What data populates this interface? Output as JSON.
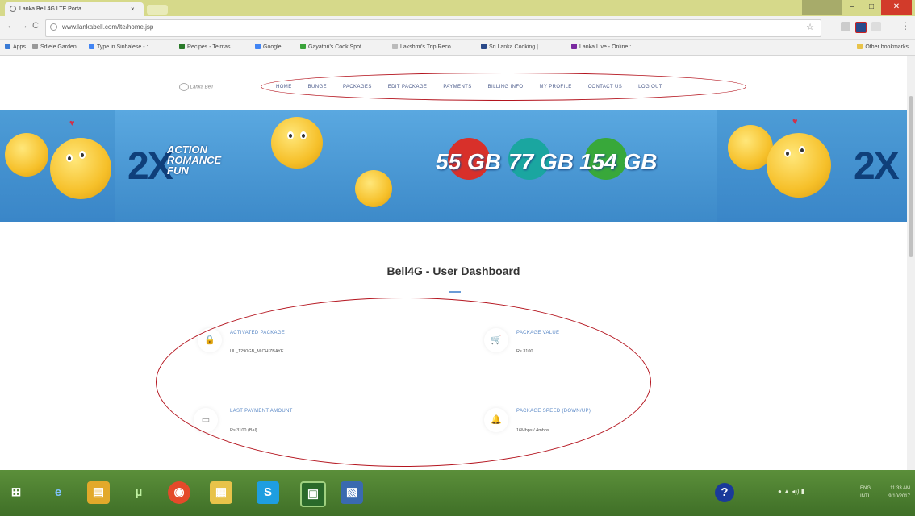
{
  "browser": {
    "tab_title": "Lanka Bell 4G LTE Porta",
    "tab_close": "×",
    "url": "www.lankabell.com/lte/home.jsp",
    "back": "←",
    "forward": "→",
    "reload": "C",
    "star": "☆",
    "menu": "⋮"
  },
  "window_controls": {
    "minimize": "–",
    "maximize": "□",
    "close": "✕"
  },
  "bookmarks": [
    {
      "label": "Apps",
      "color": "#3a7bd5"
    },
    {
      "label": "Sdlele Garden",
      "color": "#999999"
    },
    {
      "label": "Type in Sinhalese - :",
      "color": "#4285f4"
    },
    {
      "label": "Recipes - Telmas",
      "color": "#2a7a2a"
    },
    {
      "label": "Google",
      "color": "#4285f4"
    },
    {
      "label": "Gayathri's Cook Spot",
      "color": "#3aa33a"
    },
    {
      "label": "Lakshmi's Trip Reco",
      "color": "#999999"
    },
    {
      "label": "Sri Lanka Cooking |",
      "color": "#2a4a8a"
    },
    {
      "label": "Lanka Live - Online :",
      "color": "#7a2aa0"
    }
  ],
  "other_bookmarks": "Other bookmarks",
  "site": {
    "logo_text": "Lanka Bell",
    "nav": [
      "HOME",
      "BUNGE",
      "PACKAGES",
      "EDIT PACKAGE",
      "PAYMENTS",
      "BILLING INFO",
      "MY PROFILE",
      "CONTACT US",
      "LOG OUT"
    ]
  },
  "banner": {
    "big_text": "2X",
    "lines": [
      "ACTION",
      "ROMANCE",
      "FUN"
    ],
    "packages": [
      "55 GB",
      "77 GB",
      "154 GB"
    ],
    "colors": {
      "red": "#d8302a",
      "teal": "#1aa6a0",
      "green": "#38a83a"
    }
  },
  "dashboard": {
    "title": "Bell4G - User Dashboard",
    "cards": [
      {
        "label": "ACTIVATED PACKAGE",
        "value": "UL_1290GB_MICHIZBAYE",
        "icon": "lock-icon",
        "glyph": "🔒"
      },
      {
        "label": "PACKAGE VALUE",
        "value": "Rs 3100",
        "icon": "cart-icon",
        "glyph": "🛒"
      },
      {
        "label": "LAST PAYMENT AMOUNT",
        "value": "Rs 3100 (Bal)",
        "icon": "card-icon",
        "glyph": "▭"
      },
      {
        "label": "PACKAGE SPEED (DOWN/UP)",
        "value": "16Mbps / 4mbps",
        "icon": "bell-icon",
        "glyph": "🔔"
      }
    ]
  },
  "taskbar": {
    "apps": [
      "⊞",
      "e",
      "▤",
      "µ",
      "◉",
      "▦",
      "S",
      "▣",
      "▧"
    ],
    "help": "?",
    "lang": "ENG",
    "region": "INTL",
    "time": "11:33 AM",
    "date": "9/10/2017"
  }
}
